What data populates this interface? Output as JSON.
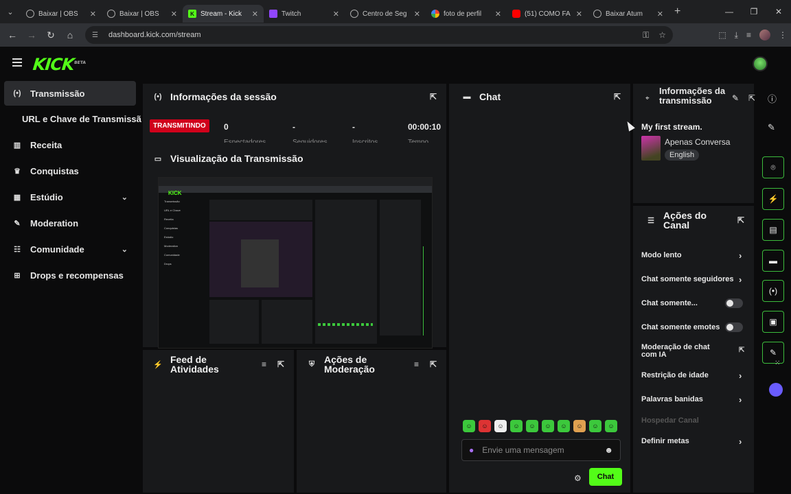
{
  "browser": {
    "tabs": [
      {
        "label": "Baixar | OBS",
        "icon": "globe-icon",
        "active": false
      },
      {
        "label": "Baixar | OBS",
        "icon": "globe-icon",
        "active": false
      },
      {
        "label": "Stream - Kick",
        "icon": "kick-icon",
        "active": true
      },
      {
        "label": "Twitch",
        "icon": "twitch-icon",
        "active": false
      },
      {
        "label": "Centro de Seg",
        "icon": "globe-icon",
        "active": false
      },
      {
        "label": "foto de perfil",
        "icon": "google-icon",
        "active": false
      },
      {
        "label": "(51) COMO FA",
        "icon": "youtube-icon",
        "active": false
      },
      {
        "label": "Baixar Atum",
        "icon": "globe-icon",
        "active": false
      }
    ],
    "url": "dashboard.kick.com/stream"
  },
  "app": {
    "logo": "KICK",
    "logo_badge": "BETA",
    "accent": "#53fc18"
  },
  "sidebar": {
    "items": [
      {
        "label": "Transmissão",
        "icon": "broadcast-icon"
      },
      {
        "label": "URL e Chave de Transmissão",
        "icon": ""
      },
      {
        "label": "Receita",
        "icon": "chart-icon"
      },
      {
        "label": "Conquistas",
        "icon": "trophy-icon"
      },
      {
        "label": "Estúdio",
        "icon": "studio-icon"
      },
      {
        "label": "Moderation",
        "icon": "wrench-icon"
      },
      {
        "label": "Comunidade",
        "icon": "community-icon"
      },
      {
        "label": "Drops e recompensas",
        "icon": "gift-icon"
      }
    ]
  },
  "session": {
    "title": "Informações da sessão",
    "live_badge": "TRANSMITINDO",
    "viewers": "0",
    "stat2": "-",
    "stat3": "-",
    "duration": "00:00:10",
    "labels": [
      "Espectadores",
      "Seguidores",
      "Inscritos",
      "Tempo"
    ]
  },
  "preview": {
    "title": "Visualização da Transmissão"
  },
  "activity": {
    "title": "Feed de Atividades"
  },
  "modactions": {
    "title": "Ações de Moderação"
  },
  "chat": {
    "title": "Chat",
    "placeholder": "Envie uma mensagem",
    "send_label": "Chat"
  },
  "stream_info": {
    "title": "Informações da transmissão",
    "stream_title": "My first stream.",
    "category": "Apenas Conversa",
    "language": "English"
  },
  "channel_actions": {
    "title": "Ações do Canal",
    "items": [
      {
        "label": "Modo lento",
        "control": "chevron"
      },
      {
        "label": "Chat somente seguidores",
        "control": "chevron"
      },
      {
        "label": "Chat somente...",
        "control": "toggle"
      },
      {
        "label": "Chat somente emotes",
        "control": "toggle"
      },
      {
        "label": "Moderação de chat com IA",
        "control": "external"
      },
      {
        "label": "Restrição de idade",
        "control": "chevron"
      },
      {
        "label": "Palavras banidas",
        "control": "chevron"
      },
      {
        "label": "Hospedar Canal",
        "control": "disabled"
      },
      {
        "label": "Definir metas",
        "control": "chevron"
      }
    ]
  }
}
